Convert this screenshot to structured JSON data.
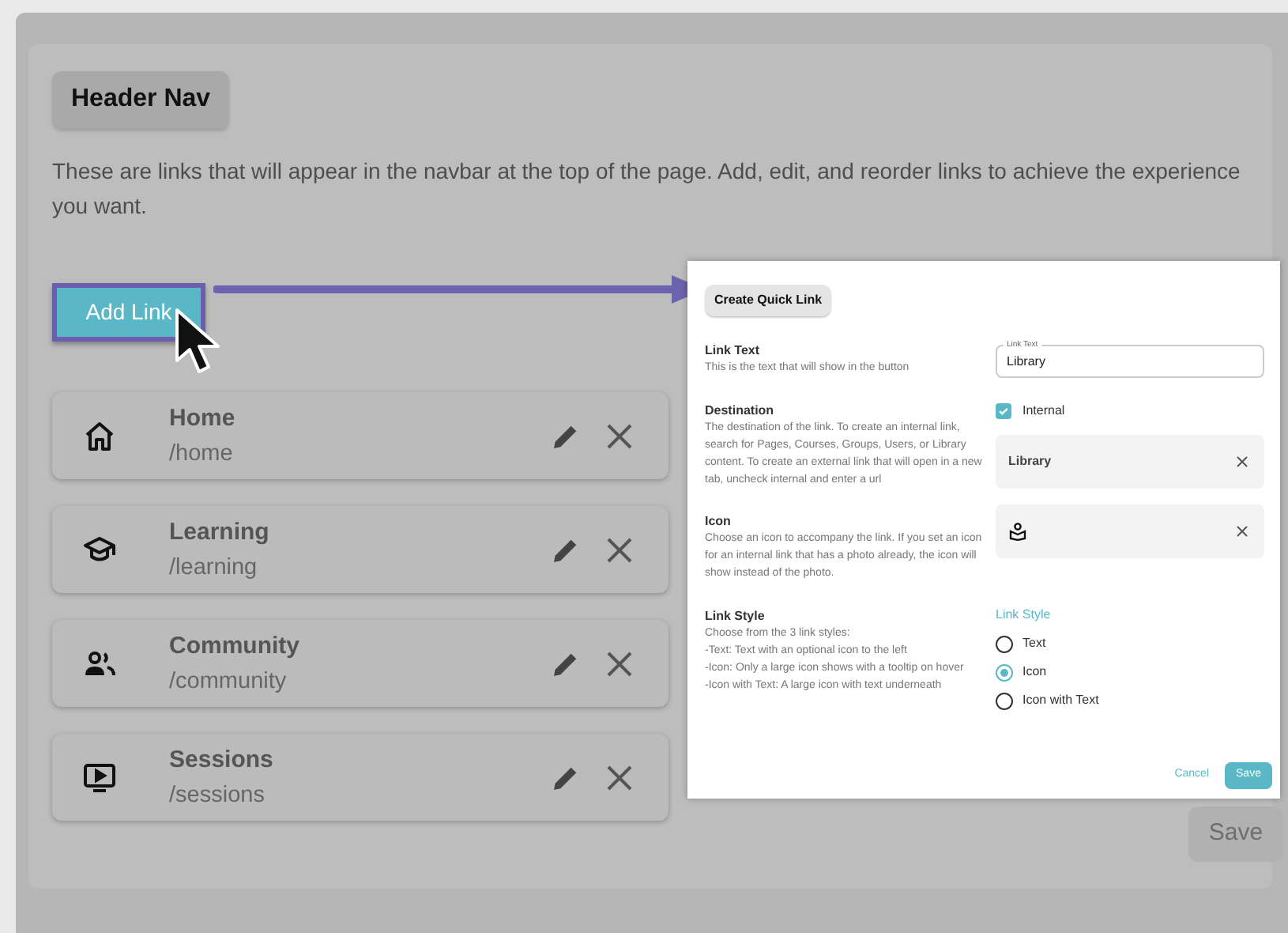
{
  "section_title": "Header Nav",
  "description": "These are links that will appear in the navbar at the top of the page. Add, edit, and reorder links to achieve the experience you want.",
  "add_button": "Add Link",
  "links": [
    {
      "title": "Home",
      "path": "/home",
      "kind": "home"
    },
    {
      "title": "Learning",
      "path": "/learning",
      "kind": "learning"
    },
    {
      "title": "Community",
      "path": "/community",
      "kind": "community"
    },
    {
      "title": "Sessions",
      "path": "/sessions",
      "kind": "sessions"
    }
  ],
  "dialog": {
    "title": "Create Quick Link",
    "rows": [
      {
        "kind": "text_field",
        "label": "Link Text",
        "help": "This is the text that will show in the button",
        "field_label": "Link Text",
        "value": "Library"
      },
      {
        "kind": "destination",
        "label": "Destination",
        "help": "The destination of the link. To create an internal link, search for Pages, Courses, Groups, Users, or Library content. To create an external link that will open in a new tab, uncheck internal and enter a url",
        "checkbox": {
          "label": "Internal",
          "checked": true
        },
        "value": "Library"
      },
      {
        "kind": "icon_select",
        "label": "Icon",
        "help": "Choose an icon to accompany the link. If you set an icon for an internal link that has a photo already, the icon will show instead of the photo."
      },
      {
        "kind": "radio_group",
        "label": "Link Style",
        "help": "Choose from the 3 link styles:\n-Text: Text with an optional icon to the left\n-Icon: Only a large icon shows with a tooltip on hover\n-Icon with Text: A large icon with text underneath",
        "group_label": "Link Style",
        "options": [
          {
            "label": "Text",
            "selected": false
          },
          {
            "label": "Icon",
            "selected": true
          },
          {
            "label": "Icon with Text",
            "selected": false
          }
        ]
      }
    ],
    "cancel": "Cancel",
    "save": "Save"
  },
  "save_button": {
    "label": "Save",
    "disabled": true
  }
}
